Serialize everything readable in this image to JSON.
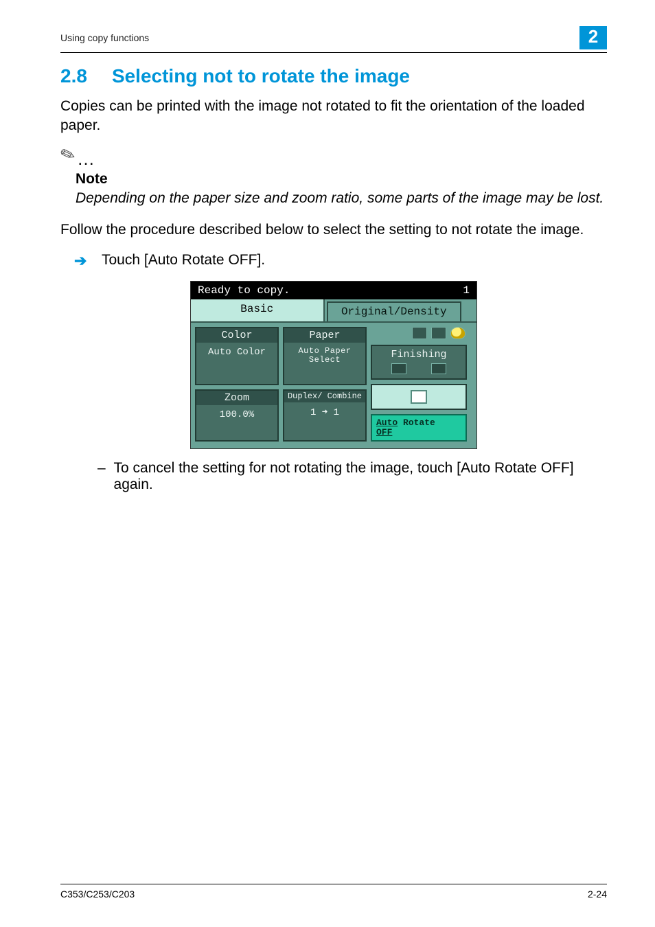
{
  "header": {
    "running_head": "Using copy functions",
    "chapter_number": "2"
  },
  "section": {
    "number": "2.8",
    "title": "Selecting not to rotate the image"
  },
  "intro": "Copies can be printed with the image not rotated to fit the orientation of the loaded paper.",
  "note": {
    "label": "Note",
    "text": "Depending on the paper size and zoom ratio, some parts of the image may be lost."
  },
  "instruction": "Follow the procedure described below to select the setting to not rotate the image.",
  "step1": "Touch [Auto Rotate OFF].",
  "substep1": "To cancel the setting for not rotating the image, touch [Auto Rotate OFF] again.",
  "lcd": {
    "status": "Ready to copy.",
    "copies": "1",
    "tabs": {
      "basic": "Basic",
      "original_density": "Original/Density"
    },
    "color": {
      "header": "Color",
      "value": "Auto Color"
    },
    "paper": {
      "header": "Paper",
      "value": "Auto Paper Select"
    },
    "zoom": {
      "header": "Zoom",
      "value": "100.0%"
    },
    "duplex": {
      "header": "Duplex/ Combine",
      "value": "1 ➜ 1"
    },
    "finishing": "Finishing",
    "auto_rotate_line1": "Auto",
    "auto_rotate_line2": "Rotate",
    "auto_rotate_line3": "OFF"
  },
  "footer": {
    "model": "C353/C253/C203",
    "page": "2-24"
  }
}
